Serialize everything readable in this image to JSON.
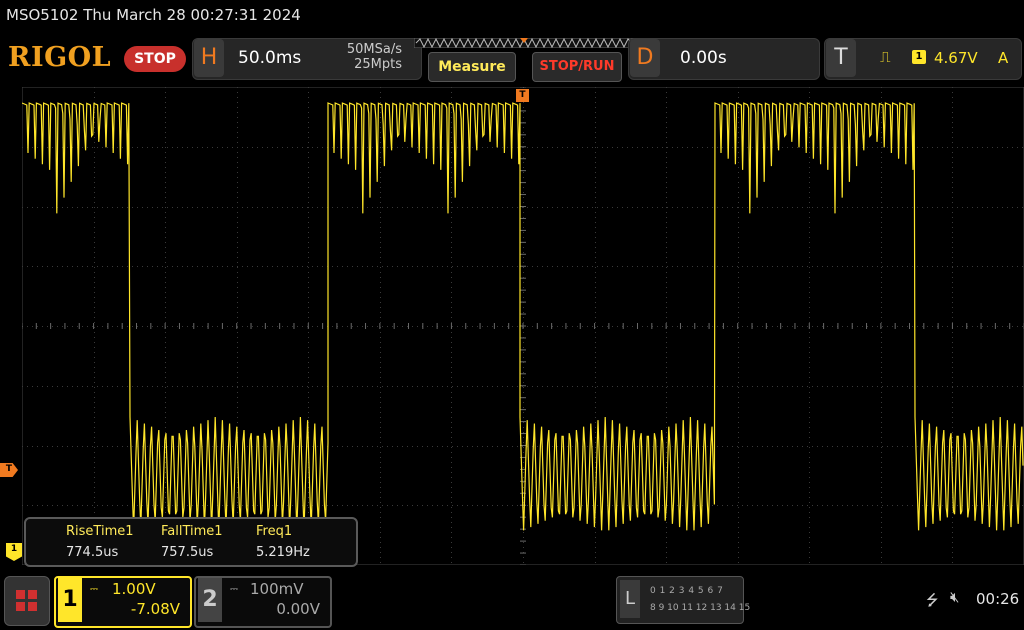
{
  "titlebar": {
    "text": "MSO5102  Thu March 28 00:27:31 2024"
  },
  "logo": {
    "text": "RIGOL"
  },
  "status": {
    "state": "STOP"
  },
  "horizontal": {
    "letter": "H",
    "timebase": "50.0ms",
    "sample_rate": "50MSa/s",
    "memory_depth": "25Mpts"
  },
  "buttons": {
    "measure": "Measure",
    "stop_run": "STOP/RUN"
  },
  "delay": {
    "letter": "D",
    "value": "0.00s"
  },
  "trigger": {
    "letter": "T",
    "edge_icon": "rising-edge-icon",
    "source": "1",
    "level": "4.67V",
    "mode": "A"
  },
  "markers": {
    "trigger_position": "T",
    "trigger_level": "T",
    "ch1_offset": "1"
  },
  "measurements": {
    "headers": [
      "RiseTime1",
      "FallTime1",
      "Freq1"
    ],
    "values": [
      "774.5us",
      "757.5us",
      "5.219Hz"
    ]
  },
  "channels": [
    {
      "number": "1",
      "scale": "1.00V",
      "offset": "-7.08V",
      "coupling_icon": "dc-coupling-icon",
      "active": true
    },
    {
      "number": "2",
      "scale": "100mV",
      "offset": "0.00V",
      "coupling_icon": "dc-coupling-icon",
      "active": false
    }
  ],
  "logic_analyzer": {
    "letter": "L",
    "row1": "0 1 2 3  4 5 6 7",
    "row2": "8 9 10 11 12 13 14 15"
  },
  "system": {
    "clock": "00:26",
    "usb_icon": "usb-icon",
    "speaker_icon": "speaker-muted-icon"
  },
  "colors": {
    "ch1": "#ffe62a",
    "accent_orange": "#f07a20",
    "stop_red": "#c8302c",
    "grid": "#3c3c3c"
  }
}
